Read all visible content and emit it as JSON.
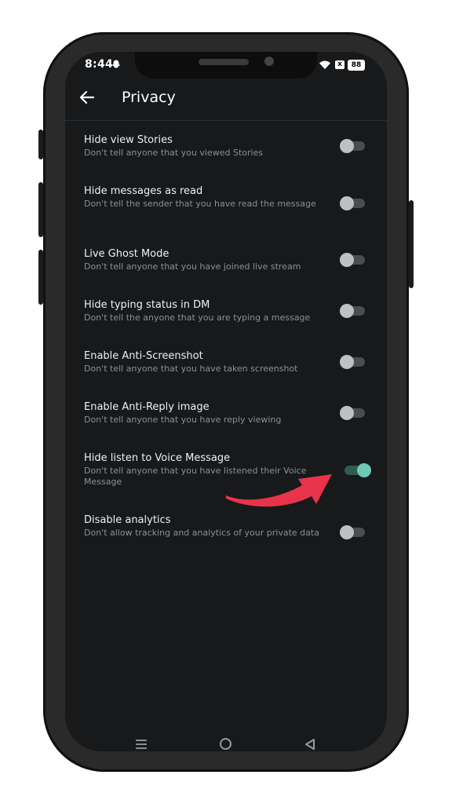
{
  "status_bar": {
    "time": "8:44",
    "battery": "88",
    "x_badge": "x"
  },
  "header": {
    "title": "Privacy"
  },
  "settings": [
    {
      "title": "Hide view Stories",
      "desc": "Don't tell anyone that you viewed Stories",
      "enabled": false
    },
    {
      "title": "Hide messages as read",
      "desc": "Don't tell the sender that you have read the message",
      "enabled": false
    },
    {
      "title": "Live Ghost Mode",
      "desc": "Don't tell anyone that you have joined live stream",
      "enabled": false
    },
    {
      "title": "Hide typing status in DM",
      "desc": "Don't tell the anyone that you are typing a message",
      "enabled": false
    },
    {
      "title": "Enable Anti-Screenshot",
      "desc": "Don't tell anyone that you have taken screenshot",
      "enabled": false
    },
    {
      "title": "Enable Anti-Reply image",
      "desc": "Don't tell anyone that you have reply viewing",
      "enabled": false
    },
    {
      "title": "Hide listen to Voice Message",
      "desc": "Don't tell anyone that you have listened their Voice Message",
      "enabled": true
    },
    {
      "title": "Disable analytics",
      "desc": "Don't allow tracking and analytics of your private data",
      "enabled": false
    }
  ],
  "colors": {
    "background": "#17191b",
    "toggle_on": "#6fc8b6",
    "toggle_off": "#bfc0c2",
    "arrow": "#e8344a"
  },
  "icons": {
    "back": "arrow-left-icon",
    "nav_recents": "recents-icon",
    "nav_home": "home-icon",
    "nav_back": "back-triangle-icon"
  }
}
